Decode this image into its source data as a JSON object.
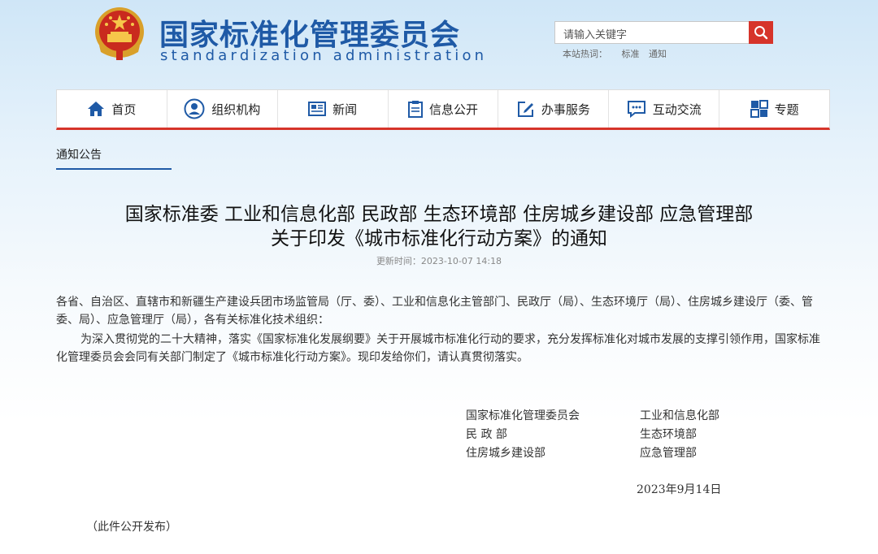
{
  "header": {
    "title": "国家标准化管理委员会",
    "subtitle": "standardization administration",
    "search_placeholder": "请输入关键字",
    "hot_label": "本站热词：",
    "hot_words": [
      "标准",
      "通知"
    ]
  },
  "nav": [
    "首页",
    "组织机构",
    "新闻",
    "信息公开",
    "办事服务",
    "互动交流",
    "专题"
  ],
  "breadcrumb": "通知公告",
  "article": {
    "title_line1": "国家标准委 工业和信息化部 民政部 生态环境部 住房城乡建设部 应急管理部",
    "title_line2": "关于印发《城市标准化行动方案》的通知",
    "update_time": "更新时间：2023-10-07 14:18",
    "para1": "各省、自治区、直辖市和新疆生产建设兵团市场监管局（厅、委）、工业和信息化主管部门、民政厅（局）、生态环境厅（局）、住房城乡建设厅（委、管委、局）、应急管理厅（局），各有关标准化技术组织：",
    "para2": "为深入贯彻党的二十大精神，落实《国家标准化发展纲要》关于开展城市标准化行动的要求，充分发挥标准化对城市发展的支撑引领作用，国家标准化管理委员会会同有关部门制定了《城市标准化行动方案》。现印发给你们，请认真贯彻落实。",
    "signatories": [
      "国家标准化管理委员会",
      "工业和信息化部",
      "民 政 部",
      "生态环境部",
      "住房城乡建设部",
      "应急管理部"
    ],
    "date": "2023年9月14日",
    "note": "（此件公开发布）"
  },
  "colors": {
    "brand_blue": "#1f5aa6",
    "accent_red": "#d6342a"
  }
}
